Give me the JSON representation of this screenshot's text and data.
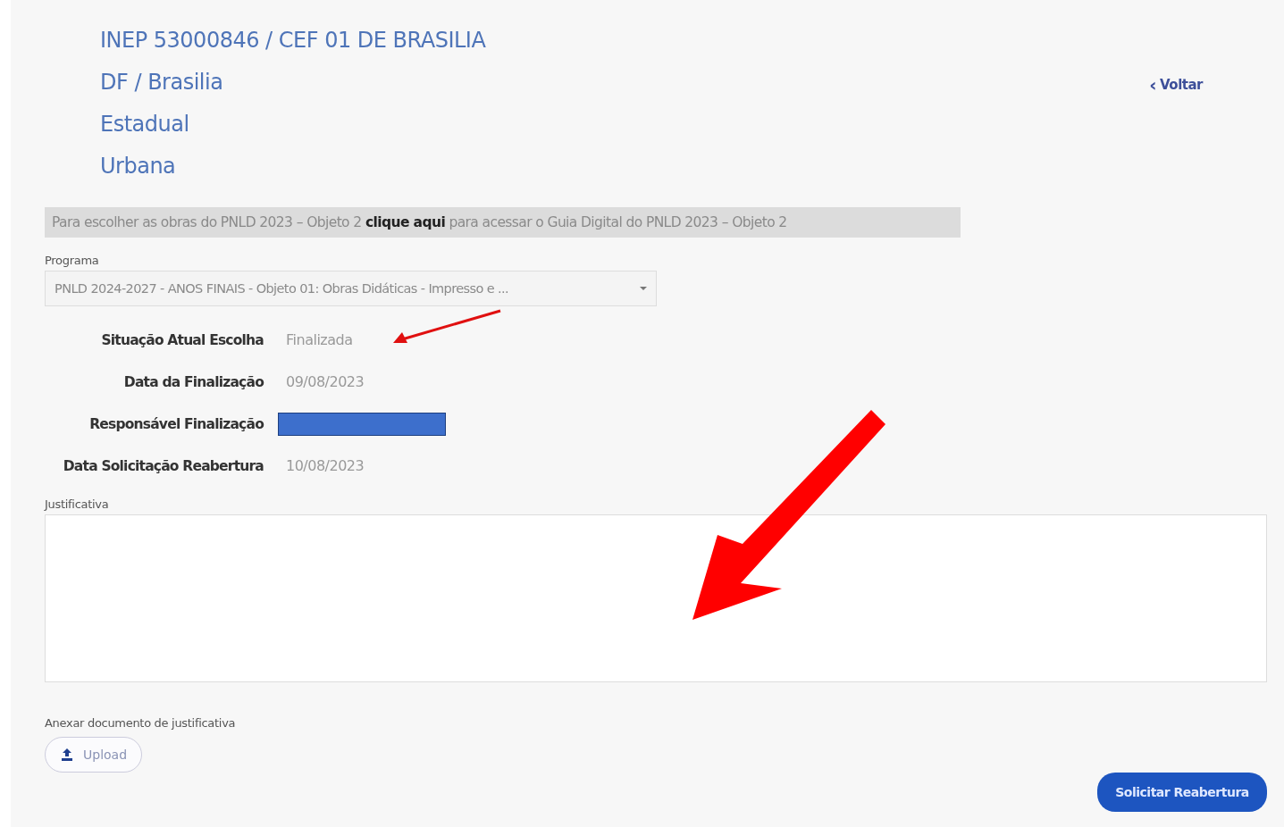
{
  "header": {
    "lines": [
      "INEP 53000846 / CEF 01 DE BRASILIA",
      "DF / Brasilia",
      "Estadual",
      "Urbana"
    ],
    "back_link": {
      "icon": "‹",
      "label": "Voltar"
    }
  },
  "notice": {
    "text": "Para escolher as obras do PNLD 2023 – Objeto 2 **clique aqui** para acessar o Guia Digital do PNLD 2023 – Objeto 2"
  },
  "program": {
    "label": "Programa",
    "value": "PNLD 2024-2027 - ANOS FINAIS - Objeto 01: Obras Didáticas - Impresso e ..."
  },
  "details": [
    {
      "label": "Situação Atual Escolha",
      "kind": "text",
      "value": "Finalizada"
    },
    {
      "label": "Data da Finalização",
      "kind": "text",
      "value": "09/08/2023"
    },
    {
      "label": "Responsável Finalização",
      "kind": "redacted"
    },
    {
      "label": "Data Solicitação Reabertura",
      "kind": "text",
      "value": "10/08/2023"
    }
  ],
  "justification": {
    "label": "Justificativa"
  },
  "attachment": {
    "label": "Anexar documento de justificativa",
    "button": "Upload"
  },
  "submit_button": "Solicitar Reabertura"
}
